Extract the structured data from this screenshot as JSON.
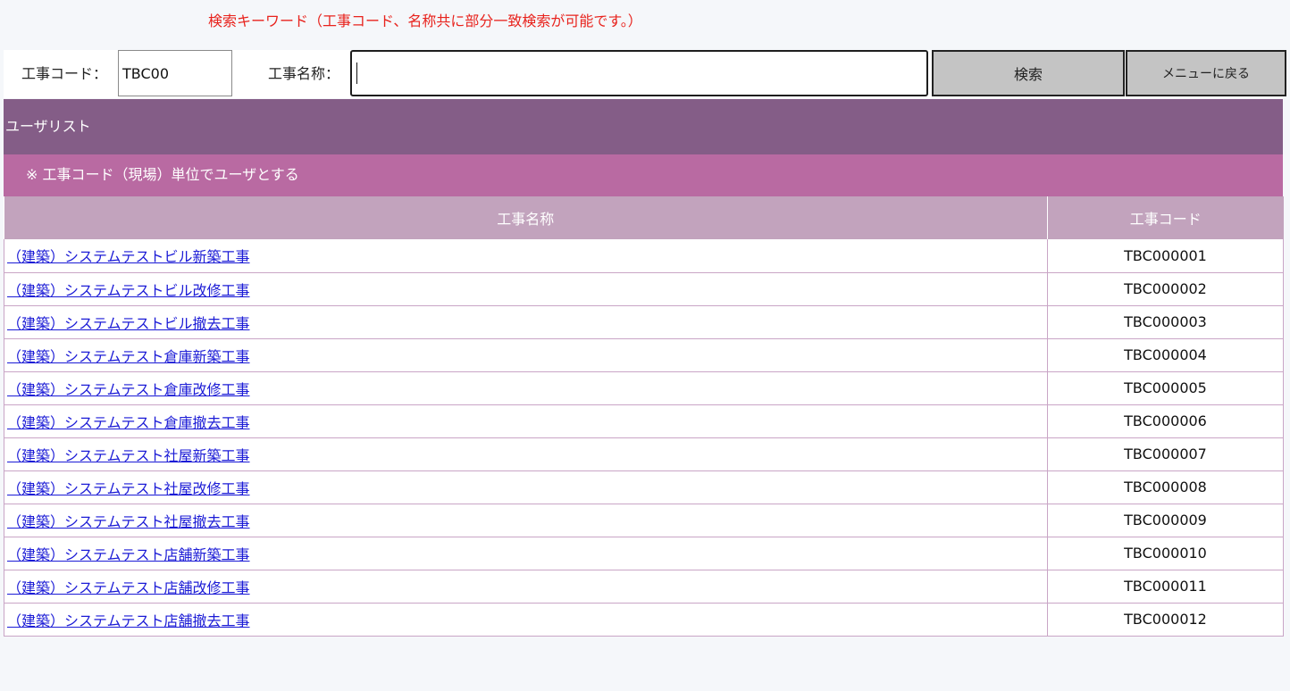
{
  "search": {
    "hint": "検索キーワード（工事コード、名称共に部分一致検索が可能です。）",
    "code_label": "工事コード：",
    "code_value": "TBC00",
    "name_label": "工事名称：",
    "name_value": "",
    "search_button": "検索",
    "menu_button": "メニューに戻る"
  },
  "list": {
    "title": "ユーザリスト",
    "note": "※ 工事コード（現場）単位でユーザとする",
    "columns": [
      "工事名称",
      "工事コード"
    ],
    "rows": [
      {
        "name": "（建築）システムテストビル新築工事",
        "code": "TBC000001"
      },
      {
        "name": "（建築）システムテストビル改修工事",
        "code": "TBC000002"
      },
      {
        "name": "（建築）システムテストビル撤去工事",
        "code": "TBC000003"
      },
      {
        "name": "（建築）システムテスト倉庫新築工事",
        "code": "TBC000004"
      },
      {
        "name": "（建築）システムテスト倉庫改修工事",
        "code": "TBC000005"
      },
      {
        "name": "（建築）システムテスト倉庫撤去工事",
        "code": "TBC000006"
      },
      {
        "name": "（建築）システムテスト社屋新築工事",
        "code": "TBC000007"
      },
      {
        "name": "（建築）システムテスト社屋改修工事",
        "code": "TBC000008"
      },
      {
        "name": "（建築）システムテスト社屋撤去工事",
        "code": "TBC000009"
      },
      {
        "name": "（建築）システムテスト店舗新築工事",
        "code": "TBC000010"
      },
      {
        "name": "（建築）システムテスト店舗改修工事",
        "code": "TBC000011"
      },
      {
        "name": "（建築）システムテスト店舗撤去工事",
        "code": "TBC000012"
      }
    ]
  },
  "colors": {
    "hint_text": "#e8231d",
    "list_header_bg": "#845d87",
    "list_note_bg": "#b96aa2",
    "table_header_bg": "#c2a3bd",
    "button_bg": "#c4c4c4",
    "link": "#1b1bd6"
  }
}
